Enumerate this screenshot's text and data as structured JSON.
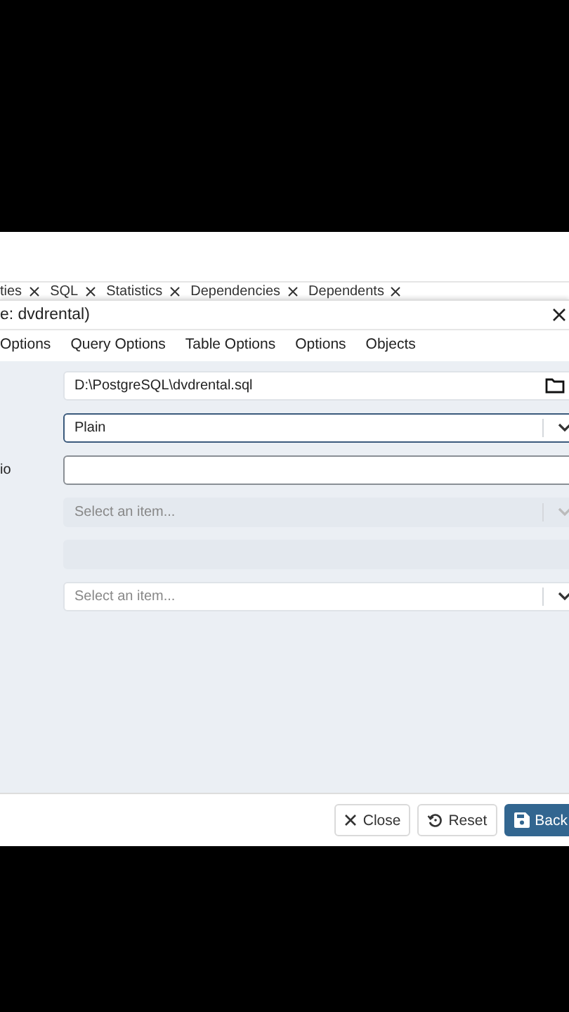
{
  "background_tabs": [
    {
      "label": "ties"
    },
    {
      "label": "SQL"
    },
    {
      "label": "Statistics"
    },
    {
      "label": "Dependencies"
    },
    {
      "label": "Dependents"
    }
  ],
  "dialog": {
    "title": "e: dvdrental)",
    "tabs": [
      {
        "label": "Options",
        "selected": false
      },
      {
        "label": "Query Options",
        "selected": false
      },
      {
        "label": "Table Options",
        "selected": false
      },
      {
        "label": "Options",
        "selected": false
      },
      {
        "label": "Objects",
        "selected": false
      }
    ],
    "fields": [
      {
        "kind": "file",
        "value": "D:\\PostgreSQL\\dvdrental.sql",
        "focused": false,
        "disabled": false
      },
      {
        "kind": "select",
        "value": "Plain",
        "focused": true,
        "disabled": false
      },
      {
        "kind": "text",
        "label": "io",
        "focused": false,
        "disabled": false
      },
      {
        "kind": "select",
        "placeholder": "Select an item...",
        "focused": false,
        "disabled": true
      },
      {
        "kind": "text",
        "focused": false,
        "disabled": true
      },
      {
        "kind": "select",
        "placeholder": "Select an item...",
        "focused": false,
        "disabled": false
      }
    ],
    "buttons": [
      {
        "kind": "close",
        "label": "Close"
      },
      {
        "kind": "reset",
        "label": "Reset"
      },
      {
        "kind": "primary",
        "label": "Back"
      }
    ]
  }
}
